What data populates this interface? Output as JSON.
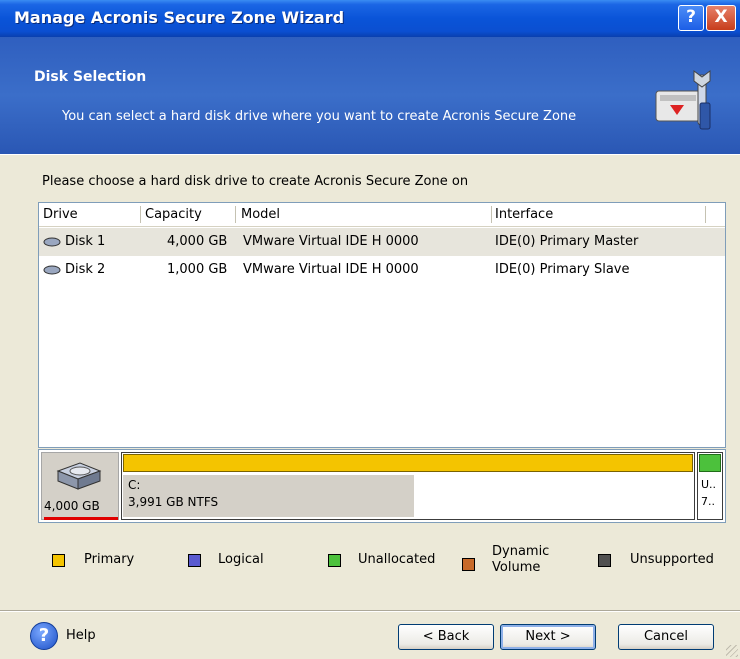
{
  "window": {
    "title": "Manage Acronis Secure Zone Wizard",
    "help_glyph": "?",
    "close_glyph": "X"
  },
  "header": {
    "title": "Disk Selection",
    "subtitle": "You can select a hard disk drive where you want to create Acronis Secure Zone"
  },
  "main": {
    "prompt": "Please choose a hard disk drive to create Acronis Secure Zone on",
    "columns": [
      "Drive",
      "Capacity",
      "Model",
      "Interface"
    ],
    "rows": [
      {
        "drive": "Disk 1",
        "capacity": "4,000 GB",
        "model": "VMware Virtual IDE H 0000",
        "interface": "IDE(0) Primary Master",
        "selected": true
      },
      {
        "drive": "Disk 2",
        "capacity": "1,000 GB",
        "model": "VMware Virtual IDE H 0000",
        "interface": "IDE(0) Primary Slave",
        "selected": false
      }
    ]
  },
  "diskmap": {
    "disk_capacity": "4,000 GB",
    "partition": {
      "label": "C:",
      "detail": "3,991 GB  NTFS",
      "used_fraction": 0.51
    },
    "unallocated": {
      "label": "U..",
      "detail": "7.."
    }
  },
  "legend": [
    {
      "label": "Primary",
      "color": "#f4c400"
    },
    {
      "label": "Logical",
      "color": "#5a5ad0"
    },
    {
      "label": "Unallocated",
      "color": "#4cc13c"
    },
    {
      "label": "Dynamic Volume",
      "color": "#c86a2a"
    },
    {
      "label": "Unsupported",
      "color": "#505050"
    }
  ],
  "footer": {
    "help_label": "Help",
    "back_label": "< Back",
    "next_label": "Next >",
    "cancel_label": "Cancel"
  },
  "colors": {
    "titlebar": "#0a54d8",
    "header_band": "#3b6ec9",
    "dialog_bg": "#ece9d8"
  }
}
